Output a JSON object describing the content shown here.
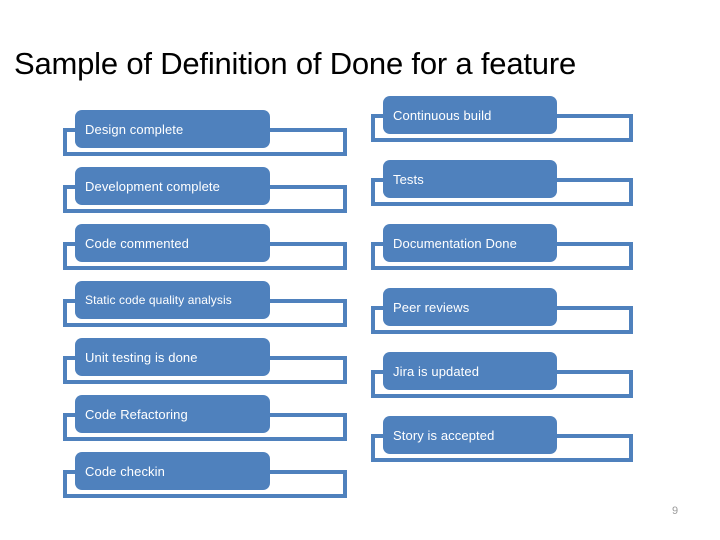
{
  "slide": {
    "title": "Sample of Definition of Done for a feature",
    "page_number": "9",
    "accent_color": "#4F81BD",
    "title_color": "#000000",
    "label_color": "#FFFFFF",
    "page_number_color": "#9A9A9A",
    "background_color": "#FFFFFF"
  },
  "columns": {
    "left": {
      "items": [
        {
          "label": "Design complete"
        },
        {
          "label": "Development complete"
        },
        {
          "label": "Code commented"
        },
        {
          "label": "Static code quality analysis"
        },
        {
          "label": "Unit testing is done"
        },
        {
          "label": "Code Refactoring"
        },
        {
          "label": "Code checkin"
        }
      ]
    },
    "right": {
      "items": [
        {
          "label": "Continuous build"
        },
        {
          "label": "Tests"
        },
        {
          "label": "Documentation Done"
        },
        {
          "label": "Peer reviews"
        },
        {
          "label": "Jira is updated"
        },
        {
          "label": "Story is accepted"
        }
      ]
    }
  }
}
